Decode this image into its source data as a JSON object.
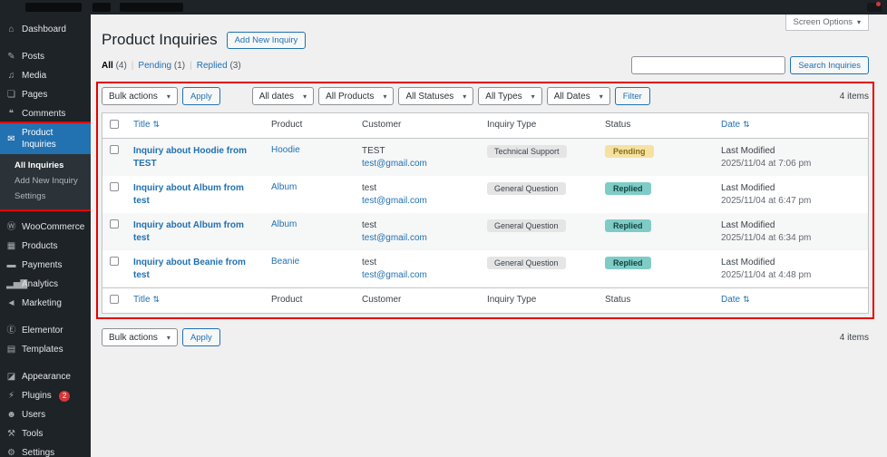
{
  "ui": {
    "chevron": "▾",
    "sort_glyph": "⇅",
    "views_separator": "|"
  },
  "sidebar": {
    "items": [
      {
        "label": "Dashboard",
        "icon": "⌂"
      },
      {
        "label": "Posts",
        "icon": "✎"
      },
      {
        "label": "Media",
        "icon": "♫"
      },
      {
        "label": "Pages",
        "icon": "❏"
      },
      {
        "label": "Comments",
        "icon": "❝"
      },
      {
        "label": "Product Inquiries",
        "icon": "✉"
      },
      {
        "label": "WooCommerce",
        "icon": "Ⓦ"
      },
      {
        "label": "Products",
        "icon": "▦"
      },
      {
        "label": "Payments",
        "icon": "▬"
      },
      {
        "label": "Analytics",
        "icon": "▂▅▇"
      },
      {
        "label": "Marketing",
        "icon": "◄"
      },
      {
        "label": "Elementor",
        "icon": "Ⓔ"
      },
      {
        "label": "Templates",
        "icon": "▤"
      },
      {
        "label": "Appearance",
        "icon": "◪"
      },
      {
        "label": "Plugins",
        "icon": "⚡",
        "badge": "2"
      },
      {
        "label": "Users",
        "icon": "☻"
      },
      {
        "label": "Tools",
        "icon": "⚒"
      },
      {
        "label": "Settings",
        "icon": "⚙"
      }
    ],
    "submenu": [
      "All Inquiries",
      "Add New Inquiry",
      "Settings"
    ]
  },
  "page": {
    "title": "Product Inquiries",
    "add_new": "Add New Inquiry",
    "screen_options": "Screen Options",
    "views": [
      {
        "label": "All",
        "count": "(4)"
      },
      {
        "label": "Pending",
        "count": "(1)"
      },
      {
        "label": "Replied",
        "count": "(3)"
      }
    ],
    "search_button": "Search Inquiries",
    "toolbar": {
      "bulk_actions": "Bulk actions",
      "apply": "Apply",
      "filters": [
        "All dates",
        "All Products",
        "All Statuses",
        "All Types",
        "All Dates"
      ],
      "filter_button": "Filter",
      "items_count": "4 items"
    },
    "table": {
      "columns": {
        "title": "Title",
        "product": "Product",
        "customer": "Customer",
        "inquiry_type": "Inquiry Type",
        "status": "Status",
        "date": "Date"
      },
      "rows": [
        {
          "title": "Inquiry about Hoodie from TEST",
          "product": "Hoodie",
          "customer_name": "TEST",
          "customer_email": "test@gmail.com",
          "inquiry_type": "Technical Support",
          "status": "Pending",
          "status_key": "pending",
          "date_label": "Last Modified",
          "date": "2025/11/04 at 7:06 pm"
        },
        {
          "title": "Inquiry about Album from test",
          "product": "Album",
          "customer_name": "test",
          "customer_email": "test@gmail.com",
          "inquiry_type": "General Question",
          "status": "Replied",
          "status_key": "replied",
          "date_label": "Last Modified",
          "date": "2025/11/04 at 6:47 pm"
        },
        {
          "title": "Inquiry about Album from test",
          "product": "Album",
          "customer_name": "test",
          "customer_email": "test@gmail.com",
          "inquiry_type": "General Question",
          "status": "Replied",
          "status_key": "replied",
          "date_label": "Last Modified",
          "date": "2025/11/04 at 6:34 pm"
        },
        {
          "title": "Inquiry about Beanie from test",
          "product": "Beanie",
          "customer_name": "test",
          "customer_email": "test@gmail.com",
          "inquiry_type": "General Question",
          "status": "Replied",
          "status_key": "replied",
          "date_label": "Last Modified",
          "date": "2025/11/04 at 4:48 pm"
        }
      ]
    }
  }
}
